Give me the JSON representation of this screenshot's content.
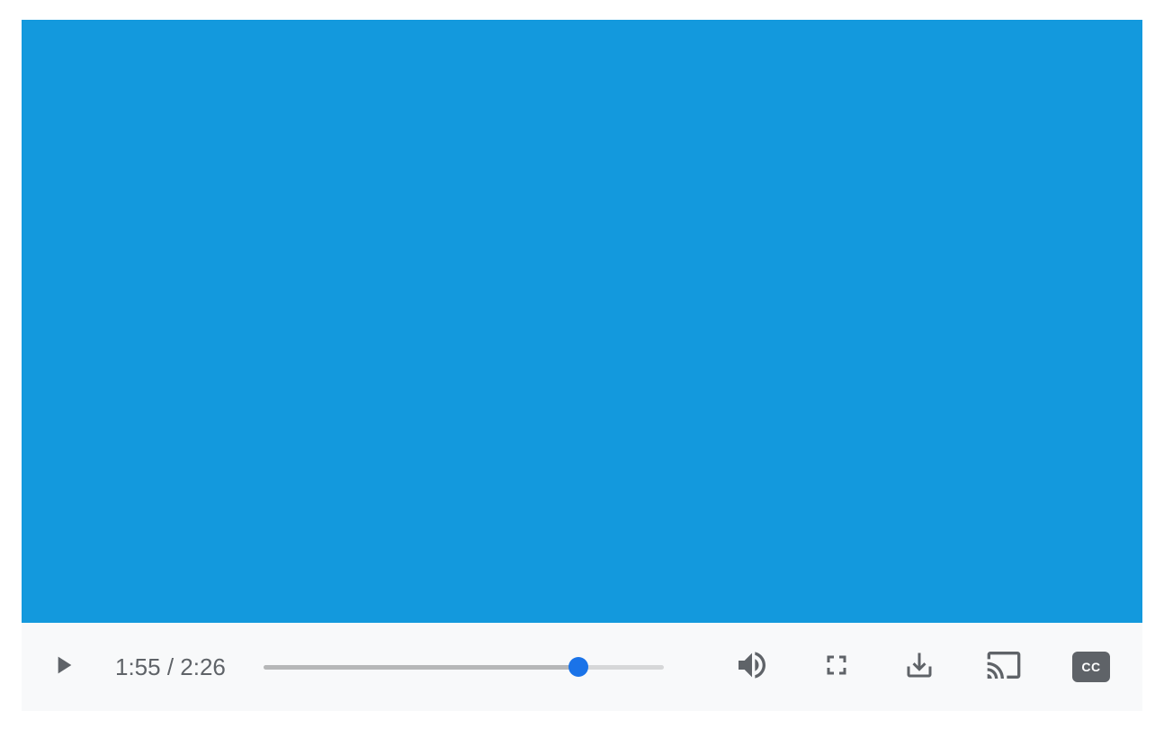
{
  "player": {
    "video_background": "#1399dd",
    "current_time": "1:55",
    "duration": "2:26",
    "time_separator": " / ",
    "progress_percent": 78.7,
    "icons": {
      "play": "play-icon",
      "volume": "volume-icon",
      "fullscreen": "fullscreen-icon",
      "download": "download-icon",
      "cast": "cast-icon",
      "cc": "cc-icon"
    },
    "cc_label": "CC"
  }
}
